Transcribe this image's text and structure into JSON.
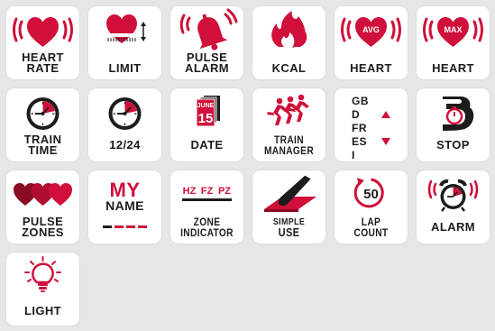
{
  "colors": {
    "accent": "#d0103a",
    "dark": "#1c1c1c",
    "tile": "#ffffff",
    "background": "#e6e6e6"
  },
  "tiles": [
    {
      "icon": "heart-waves-icon",
      "lines": [
        "HEART",
        "RATE"
      ]
    },
    {
      "icon": "heart-limit-icon",
      "lines": [
        "LIMIT"
      ]
    },
    {
      "icon": "bell-alarm-icon",
      "lines": [
        "PULSE",
        "ALARM"
      ]
    },
    {
      "icon": "flame-icon",
      "lines": [
        "KCAL"
      ]
    },
    {
      "icon": "heart-avg-icon",
      "badge": "AVG",
      "lines": [
        "HEART"
      ]
    },
    {
      "icon": "heart-max-icon",
      "badge": "MAX",
      "lines": [
        "HEART"
      ]
    },
    {
      "icon": "clock-icon",
      "lines": [
        "TRAIN",
        "TIME"
      ]
    },
    {
      "icon": "clock-icon",
      "lines": [
        "12/24"
      ]
    },
    {
      "icon": "calendar-icon",
      "month": "JUNE",
      "day": "15",
      "lines": [
        "DATE"
      ]
    },
    {
      "icon": "runners-icon",
      "lines": [
        "TRAIN",
        "MANAGER"
      ]
    },
    {
      "icon": "language-arrows-icon",
      "languages": [
        "GB",
        "D",
        "FR",
        "ES",
        "I"
      ],
      "lines": []
    },
    {
      "icon": "stopwatch-icon",
      "lines": [
        "STOP"
      ]
    },
    {
      "icon": "three-hearts-icon",
      "lines": [
        "PULSE",
        "ZONES"
      ]
    },
    {
      "icon": "my-name-icon",
      "text_top": "MY",
      "text_bottom": "NAME",
      "lines": []
    },
    {
      "icon": "zone-indicator-icon",
      "zones": [
        "HZ",
        "FZ",
        "PZ"
      ],
      "lines": [
        "ZONE",
        "INDICATOR"
      ]
    },
    {
      "icon": "finger-press-icon",
      "lines": [
        "SIMPLE",
        "USE"
      ]
    },
    {
      "icon": "lap-counter-icon",
      "count": "50",
      "lines": [
        "LAP",
        "COUNT"
      ]
    },
    {
      "icon": "alarm-clock-icon",
      "lines": [
        "ALARM"
      ]
    },
    {
      "icon": "light-bulb-icon",
      "lines": [
        "LIGHT"
      ]
    }
  ]
}
